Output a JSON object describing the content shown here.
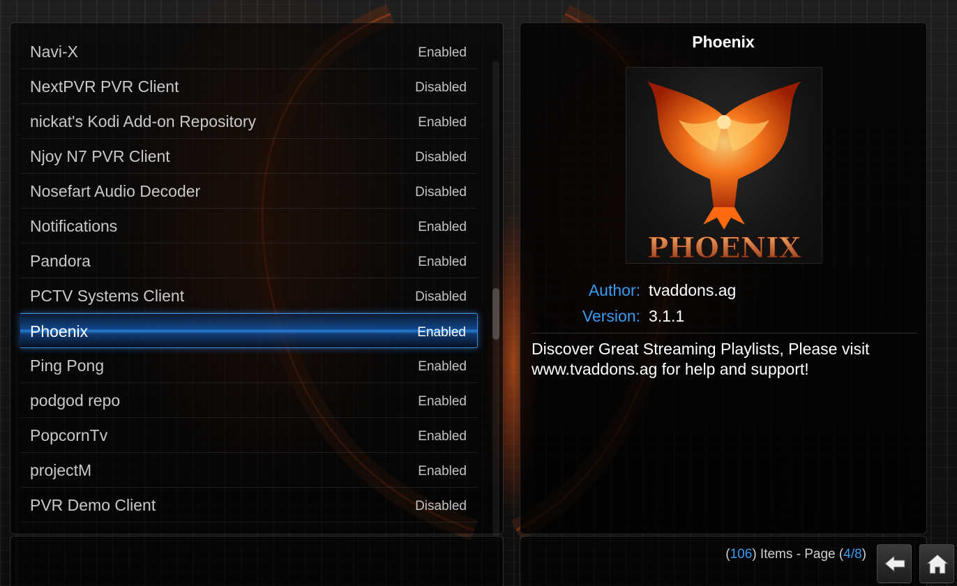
{
  "addon_list": {
    "items": [
      {
        "name": "Navi-X",
        "status": "Enabled"
      },
      {
        "name": "NextPVR PVR Client",
        "status": "Disabled"
      },
      {
        "name": "nickat's Kodi Add-on Repository",
        "status": "Enabled"
      },
      {
        "name": "Njoy N7 PVR Client",
        "status": "Disabled"
      },
      {
        "name": "Nosefart Audio Decoder",
        "status": "Disabled"
      },
      {
        "name": "Notifications",
        "status": "Enabled"
      },
      {
        "name": "Pandora",
        "status": "Enabled"
      },
      {
        "name": "PCTV Systems Client",
        "status": "Disabled"
      },
      {
        "name": "Phoenix",
        "status": "Enabled",
        "selected": true
      },
      {
        "name": "Ping Pong",
        "status": "Enabled"
      },
      {
        "name": "podgod repo",
        "status": "Enabled"
      },
      {
        "name": "PopcornTv",
        "status": "Enabled"
      },
      {
        "name": "projectM",
        "status": "Enabled"
      },
      {
        "name": "PVR Demo Client",
        "status": "Disabled"
      }
    ]
  },
  "detail": {
    "title": "Phoenix",
    "thumbnail_text": "PHOENIX",
    "author_label": "Author:",
    "author": "tvaddons.ag",
    "version_label": "Version:",
    "version": "3.1.1",
    "description": "Discover Great Streaming Playlists, Please visit www.tvaddons.ag for help and support!"
  },
  "footer": {
    "open_paren": "(",
    "item_count": "106",
    "items_text": ") Items - Page (",
    "current_page": "4",
    "slash": "/",
    "total_pages": "8",
    "close_paren": ")"
  },
  "nav": {
    "back_icon": "back-arrow-icon",
    "home_icon": "home-icon"
  },
  "colors": {
    "accent": "#3a9cf0",
    "selection": "#3a8ee6",
    "text": "#c9c9c9",
    "title": "#ffffff"
  }
}
